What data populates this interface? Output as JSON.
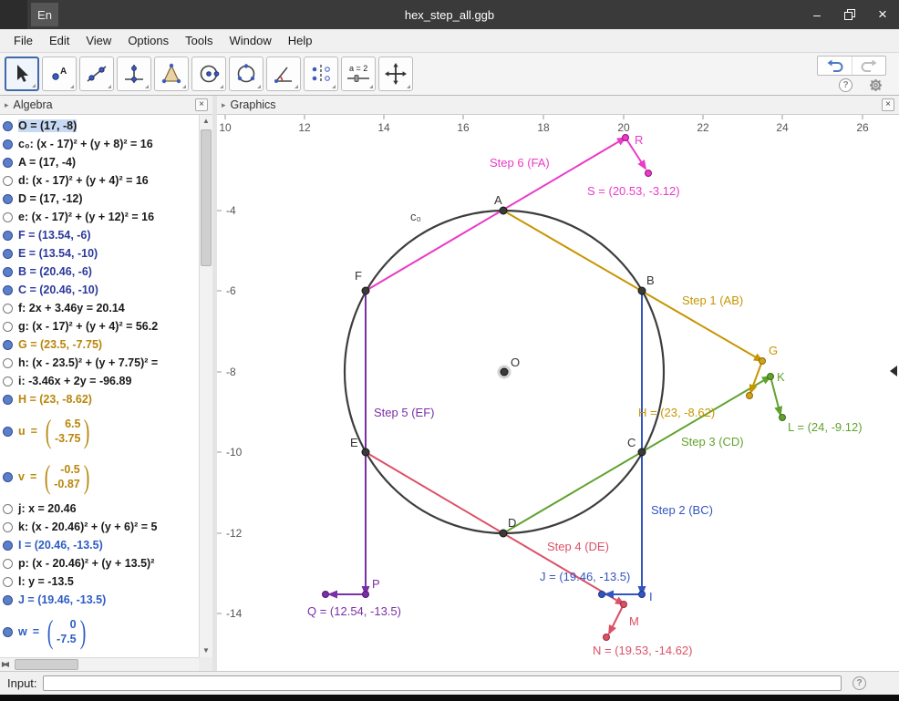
{
  "window": {
    "title": "hex_step_all.ggb",
    "language": "En"
  },
  "icons": {
    "minimize": "–",
    "close": "×",
    "triangle_right": "▸",
    "scroll_up": "▲",
    "scroll_down": "▼",
    "scroll_left": "◀",
    "scroll_right": "▶",
    "help": "?"
  },
  "menu": {
    "items": [
      "File",
      "Edit",
      "View",
      "Options",
      "Tools",
      "Window",
      "Help"
    ]
  },
  "toolbar": {
    "slider_label": "a = 2",
    "tools": [
      "move",
      "point",
      "line",
      "perpendicular-line",
      "polygon",
      "circle-center-point",
      "conic",
      "angle",
      "reflect-about-line",
      "slider",
      "move-graphics-view"
    ]
  },
  "algebra": {
    "title": "Algebra",
    "items": [
      {
        "text": "O = (17, -8)",
        "color": "#1a1a1a",
        "filled": true,
        "selected": true
      },
      {
        "text": "c₀: (x - 17)² + (y + 8)² = 16",
        "color": "#1a1a1a",
        "filled": true
      },
      {
        "text": "A = (17, -4)",
        "color": "#1a1a1a",
        "filled": true
      },
      {
        "text": "d: (x - 17)² + (y + 4)² = 16",
        "color": "#1a1a1a",
        "filled": false
      },
      {
        "text": "D = (17, -12)",
        "color": "#1a1a1a",
        "filled": true
      },
      {
        "text": "e: (x - 17)² + (y + 12)² = 16",
        "color": "#1a1a1a",
        "filled": false
      },
      {
        "text": "F = (13.54, -6)",
        "color": "#2b3a9a",
        "filled": true
      },
      {
        "text": "E = (13.54, -10)",
        "color": "#2b3a9a",
        "filled": true
      },
      {
        "text": "B = (20.46, -6)",
        "color": "#2b3a9a",
        "filled": true
      },
      {
        "text": "C = (20.46, -10)",
        "color": "#2b3a9a",
        "filled": true
      },
      {
        "text": "f: 2x + 3.46y = 20.14",
        "color": "#1a1a1a",
        "filled": false
      },
      {
        "text": "g: (x - 17)² + (y + 4)² = 56.2",
        "color": "#1a1a1a",
        "filled": false
      },
      {
        "text": "G = (23.5, -7.75)",
        "color": "#b8860b",
        "filled": true
      },
      {
        "text": "h: (x - 23.5)² + (y + 7.75)² =",
        "color": "#1a1a1a",
        "filled": false
      },
      {
        "text": "i: -3.46x + 2y = -96.89",
        "color": "#1a1a1a",
        "filled": false
      },
      {
        "text": "H = (23, -8.62)",
        "color": "#b8860b",
        "filled": true
      },
      {
        "type": "vector",
        "name": "u",
        "top": "6.5",
        "bottom": "-3.75",
        "color": "#b8860b",
        "filled": true
      },
      {
        "type": "vector",
        "name": "v",
        "top": "-0.5",
        "bottom": "-0.87",
        "color": "#b8860b",
        "filled": true
      },
      {
        "text": "j: x = 20.46",
        "color": "#1a1a1a",
        "filled": false
      },
      {
        "text": "k: (x - 20.46)² + (y + 6)² = 5",
        "color": "#1a1a1a",
        "filled": false
      },
      {
        "text": "I = (20.46, -13.5)",
        "color": "#2e5cc5",
        "filled": true
      },
      {
        "text": "p: (x - 20.46)² + (y + 13.5)²",
        "color": "#1a1a1a",
        "filled": false
      },
      {
        "text": "l: y = -13.5",
        "color": "#1a1a1a",
        "filled": false
      },
      {
        "text": "J = (19.46, -13.5)",
        "color": "#2e5cc5",
        "filled": true
      },
      {
        "type": "vector",
        "name": "w",
        "top": "0",
        "bottom": "-7.5",
        "color": "#2e5cc5",
        "filled": true
      }
    ]
  },
  "graphics": {
    "title": "Graphics",
    "x_ticks": [
      "10",
      "12",
      "14",
      "16",
      "18",
      "20",
      "22",
      "24",
      "26"
    ],
    "y_ticks": [
      "-4",
      "-6",
      "-8",
      "-10",
      "-12",
      "-14"
    ],
    "point_labels": {
      "A": "A",
      "B": "B",
      "C": "C",
      "D": "D",
      "E": "E",
      "F": "F",
      "O": "O",
      "c0": "c₀",
      "R": "R",
      "G": "G",
      "K": "K",
      "P": "P",
      "I": "I",
      "M": "M",
      "S": "S = (20.53, -3.12)",
      "H": "H = (23, -8.62)",
      "L": "L = (24, -9.12)",
      "Q": "Q = (12.54, -13.5)",
      "J": "J = (19.46, -13.5)",
      "N": "N = (19.53, -14.62)"
    },
    "step_labels": {
      "step1": "Step 1 (AB)",
      "step2": "Step 2 (BC)",
      "step3": "Step 3 (CD)",
      "step4": "Step 4 (DE)",
      "step5": "Step 5 (EF)",
      "step6": "Step 6 (FA)"
    },
    "colors": {
      "step1_gold": "#c79500",
      "step2_blue": "#3355c0",
      "step3_green": "#61a22e",
      "step4_red": "#dc5166",
      "step5_purple": "#7b2fa6",
      "step6_magenta": "#e93bc6",
      "circle": "#3d3d3d",
      "points_black": "#3a3a3a"
    }
  },
  "input": {
    "label": "Input:"
  }
}
